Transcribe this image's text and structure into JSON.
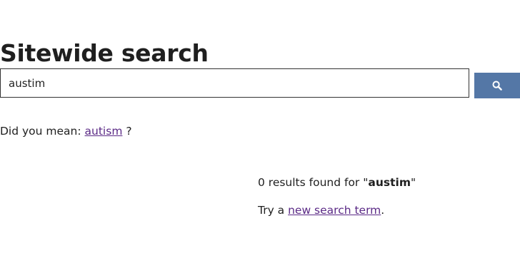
{
  "page": {
    "title": "Sitewide search"
  },
  "search": {
    "value": "austim",
    "button_icon": "search-icon",
    "button_color": "#5477a6"
  },
  "suggestion": {
    "prefix": "Did you mean: ",
    "term": "autism",
    "suffix": " ?"
  },
  "results": {
    "count_prefix": "0 results found for \"",
    "query": "austim",
    "count_suffix": "\"",
    "try_prefix": "Try a ",
    "try_link": "new search term",
    "try_suffix": "."
  },
  "colors": {
    "link": "#5b2a86",
    "text": "#1f1f1f"
  }
}
